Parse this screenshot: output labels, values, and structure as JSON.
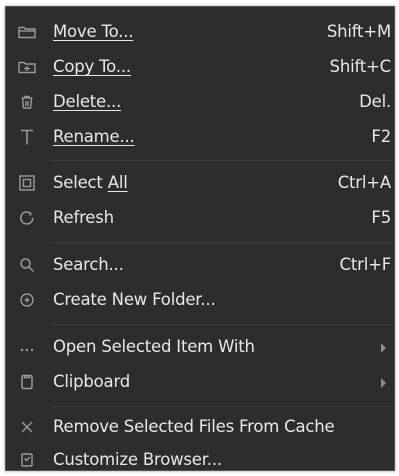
{
  "menu": {
    "items": [
      {
        "label": "Move To...",
        "shortcut": "Shift+M",
        "icon": "folder-move-icon"
      },
      {
        "label": "Copy To...",
        "shortcut": "Shift+C",
        "icon": "folder-copy-icon"
      },
      {
        "label": "Delete...",
        "shortcut": "Del.",
        "icon": "trash-icon"
      },
      {
        "label": "Rename...",
        "shortcut": "F2",
        "icon": "text-rename-icon"
      },
      {
        "label_pre": "Select ",
        "label_accel": "All",
        "shortcut": "Ctrl+A",
        "icon": "select-all-icon"
      },
      {
        "label": "Refresh",
        "shortcut": "F5",
        "icon": "refresh-icon"
      },
      {
        "label": "Search...",
        "shortcut": "Ctrl+F",
        "icon": "search-icon"
      },
      {
        "label": "Create New Folder...",
        "icon": "add-circle-icon"
      },
      {
        "label": "Open Selected Item With",
        "icon": "more-dots-icon",
        "submenu": true
      },
      {
        "label": "Clipboard",
        "icon": "clipboard-icon",
        "submenu": true
      },
      {
        "label": "Remove Selected Files From Cache",
        "icon": "close-x-icon"
      },
      {
        "label": "Customize Browser...",
        "icon": "customize-icon"
      }
    ]
  }
}
